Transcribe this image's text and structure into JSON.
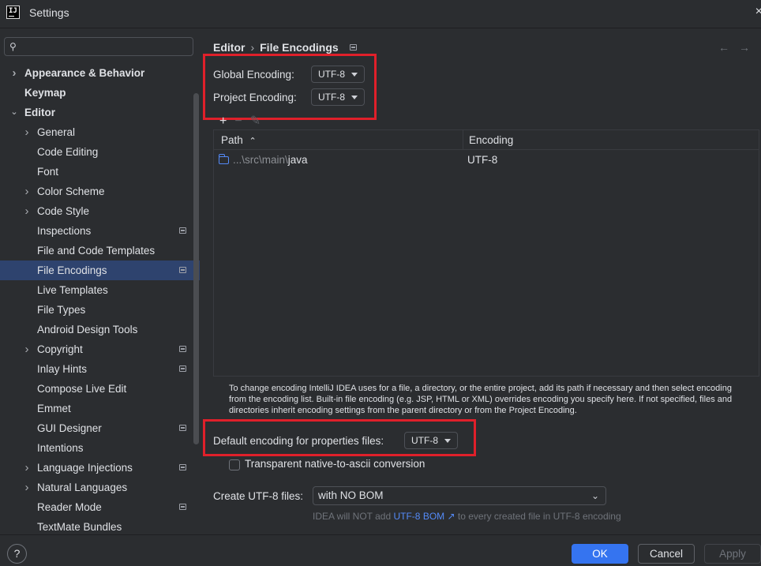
{
  "window": {
    "title": "Settings",
    "logo": "IJ",
    "close": "×"
  },
  "sidebar": {
    "search_placeholder": "",
    "search_icon": "⚲",
    "items": [
      {
        "label": "Appearance & Behavior",
        "bold": true,
        "chevron": "right",
        "indent": 0
      },
      {
        "label": "Keymap",
        "bold": true,
        "chevron": "",
        "indent": 0
      },
      {
        "label": "Editor",
        "bold": true,
        "chevron": "down",
        "indent": 0
      },
      {
        "label": "General",
        "chevron": "right",
        "indent": 1
      },
      {
        "label": "Code Editing",
        "chevron": "",
        "indent": 1
      },
      {
        "label": "Font",
        "chevron": "",
        "indent": 1
      },
      {
        "label": "Color Scheme",
        "chevron": "right",
        "indent": 1
      },
      {
        "label": "Code Style",
        "chevron": "right",
        "indent": 1
      },
      {
        "label": "Inspections",
        "chevron": "",
        "indent": 1,
        "badge": true
      },
      {
        "label": "File and Code Templates",
        "chevron": "",
        "indent": 1
      },
      {
        "label": "File Encodings",
        "chevron": "",
        "indent": 1,
        "badge": true,
        "selected": true
      },
      {
        "label": "Live Templates",
        "chevron": "",
        "indent": 1
      },
      {
        "label": "File Types",
        "chevron": "",
        "indent": 1
      },
      {
        "label": "Android Design Tools",
        "chevron": "",
        "indent": 1
      },
      {
        "label": "Copyright",
        "chevron": "right",
        "indent": 1,
        "badge": true
      },
      {
        "label": "Inlay Hints",
        "chevron": "",
        "indent": 1,
        "badge": true
      },
      {
        "label": "Compose Live Edit",
        "chevron": "",
        "indent": 1
      },
      {
        "label": "Emmet",
        "chevron": "",
        "indent": 1
      },
      {
        "label": "GUI Designer",
        "chevron": "",
        "indent": 1,
        "badge": true
      },
      {
        "label": "Intentions",
        "chevron": "",
        "indent": 1
      },
      {
        "label": "Language Injections",
        "chevron": "right",
        "indent": 1,
        "badge": true
      },
      {
        "label": "Natural Languages",
        "chevron": "right",
        "indent": 1
      },
      {
        "label": "Reader Mode",
        "chevron": "",
        "indent": 1,
        "badge": true
      },
      {
        "label": "TextMate Bundles",
        "chevron": "",
        "indent": 1
      }
    ]
  },
  "main": {
    "breadcrumb": [
      "Editor",
      "File Encodings"
    ],
    "breadcrumb_sep": "›",
    "nav_back": "←",
    "nav_forward": "→",
    "global_encoding_label": "Global Encoding:",
    "global_encoding_value": "UTF-8",
    "project_encoding_label": "Project Encoding:",
    "project_encoding_value": "UTF-8",
    "toolbar": {
      "add": "+",
      "remove": "−",
      "edit": "✎"
    },
    "table": {
      "columns": [
        "Path",
        "Encoding"
      ],
      "sort_icon": "⌃",
      "rows": [
        {
          "path_prefix": "...\\src\\main\\",
          "path_name": "java",
          "encoding": "UTF-8"
        }
      ]
    },
    "help_text": "To change encoding IntelliJ IDEA uses for a file, a directory, or the entire project, add its path if necessary and then select encoding from the encoding list. Built-in file encoding (e.g. JSP, HTML or XML) overrides encoding you specify here. If not specified, files and directories inherit encoding settings from the parent directory or from the Project Encoding.",
    "properties_label": "Default encoding for properties files:",
    "properties_value": "UTF-8",
    "native_ascii_label": "Transparent native-to-ascii conversion",
    "create_utf8_label": "Create UTF-8 files:",
    "create_utf8_value": "with NO BOM",
    "bom_note_prefix": "IDEA will NOT add ",
    "bom_note_link": "UTF-8 BOM ↗",
    "bom_note_suffix": " to every created file in UTF-8 encoding"
  },
  "footer": {
    "help": "?",
    "ok": "OK",
    "cancel": "Cancel",
    "apply": "Apply"
  },
  "colors": {
    "accent": "#3574f0",
    "highlight": "#e0202a",
    "selection": "#2e436e"
  }
}
